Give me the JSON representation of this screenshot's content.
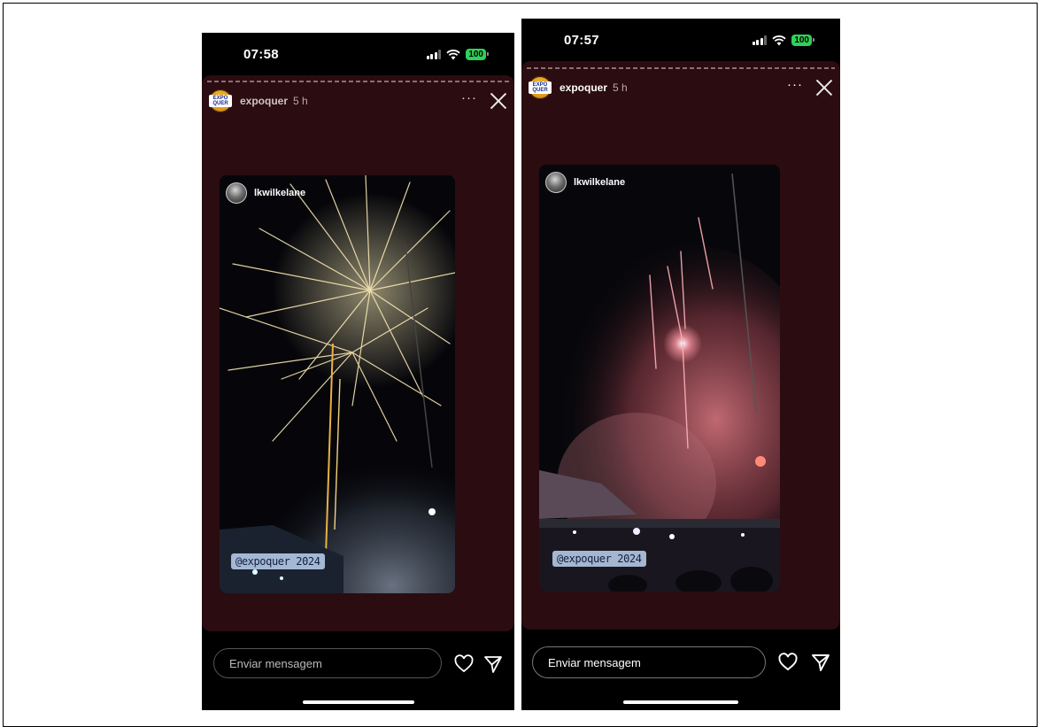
{
  "stories": [
    {
      "status_time": "07:58",
      "battery": "100",
      "account": "expoquer",
      "age": "5 h",
      "logo_text": "EXPO QUER",
      "embedded_user": "lkwilkelane",
      "tag": "@expoquer 2024",
      "message_placeholder": "Enviar mensagem",
      "more_label": "···"
    },
    {
      "status_time": "07:57",
      "battery": "100",
      "account": "expoquer",
      "age": "5 h",
      "logo_text": "EXPO QUER",
      "embedded_user": "lkwilkelane",
      "tag": "@expoquer 2024",
      "message_placeholder": "Enviar mensagem",
      "more_label": "···"
    }
  ],
  "icons": {
    "signal": "cellular-signal-icon",
    "wifi": "wifi-icon",
    "close": "close-icon",
    "heart": "heart-icon",
    "send": "send-icon"
  },
  "colors": {
    "story_background": "#2b0c10",
    "battery": "#30d158"
  }
}
